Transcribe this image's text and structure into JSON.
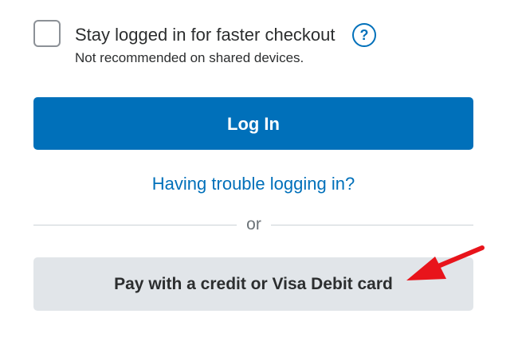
{
  "remember": {
    "label": "Stay logged in for faster checkout",
    "note": "Not recommended on shared devices.",
    "help_symbol": "?",
    "help_icon": "question-circle-icon"
  },
  "login_button": "Log In",
  "trouble_link": "Having trouble logging in?",
  "divider_text": "or",
  "card_button": "Pay with a credit or Visa Debit card",
  "annotation": {
    "icon": "red-arrow-icon",
    "color": "#e8141b"
  },
  "colors": {
    "primary": "#0070ba",
    "secondary_button": "#e1e5e9",
    "text": "#2c2e2f"
  }
}
